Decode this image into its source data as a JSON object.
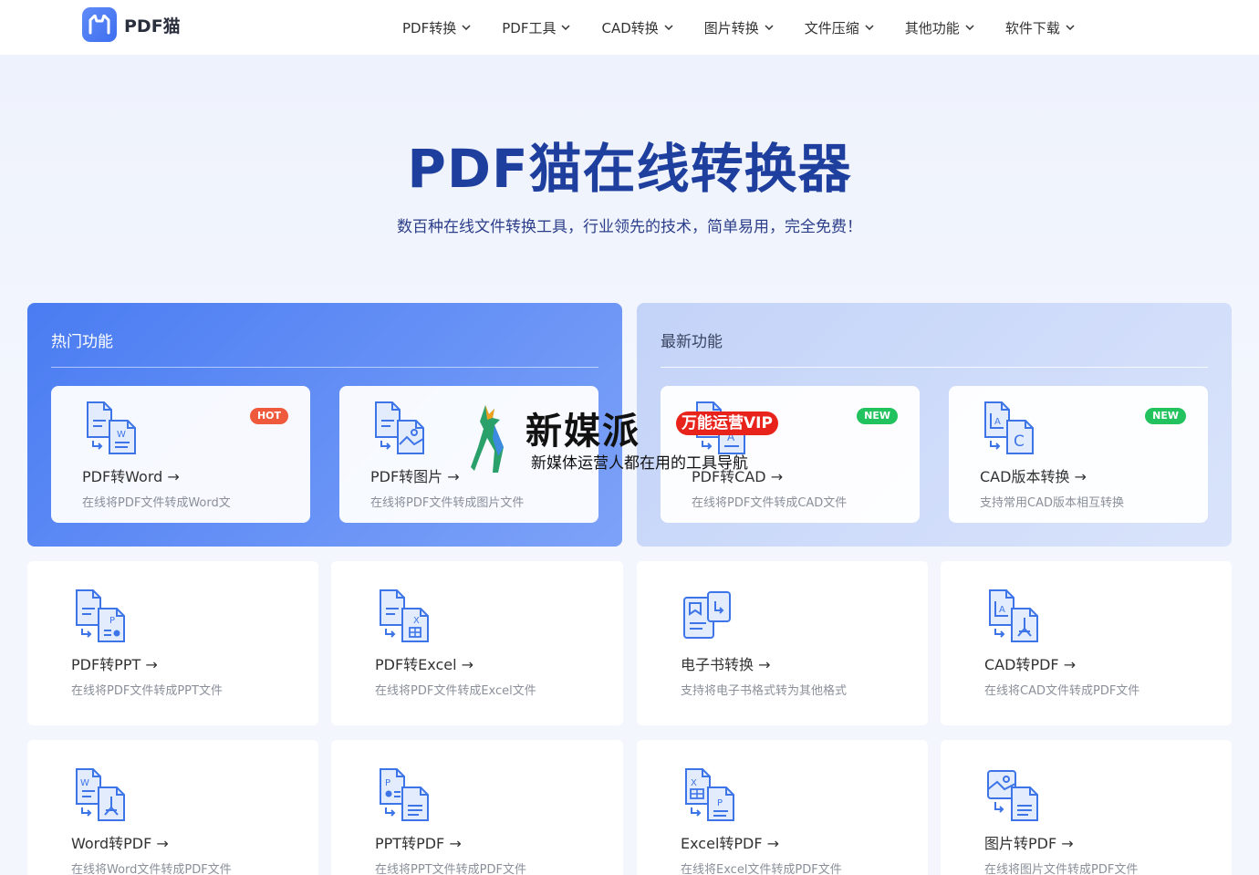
{
  "brand": {
    "name": "PDF猫"
  },
  "nav": [
    {
      "label": "PDF转换"
    },
    {
      "label": "PDF工具"
    },
    {
      "label": "CAD转换"
    },
    {
      "label": "图片转换"
    },
    {
      "label": "文件压缩"
    },
    {
      "label": "其他功能"
    },
    {
      "label": "软件下载"
    }
  ],
  "hero": {
    "title": "PDF猫在线转换器",
    "subtitle": "数百种在线文件转换工具，行业领先的技术，简单易用，完全免费！"
  },
  "hot": {
    "title": "热门功能",
    "cards": [
      {
        "title": "PDF转Word →",
        "desc": "在线将PDF文件转成Word文",
        "badge": "HOT",
        "icon": "pdf-to-word-icon"
      },
      {
        "title": "PDF转图片 →",
        "desc": "在线将PDF文件转成图片文件",
        "badge": "",
        "icon": "pdf-to-image-icon"
      }
    ]
  },
  "latest": {
    "title": "最新功能",
    "cards": [
      {
        "title": "PDF转CAD →",
        "desc": "在线将PDF文件转成CAD文件",
        "badge": "NEW",
        "icon": "pdf-to-cad-icon"
      },
      {
        "title": "CAD版本转换 →",
        "desc": "支持常用CAD版本相互转换",
        "badge": "NEW",
        "icon": "cad-version-convert-icon"
      }
    ]
  },
  "tools": [
    {
      "title": "PDF转PPT →",
      "desc": "在线将PDF文件转成PPT文件",
      "icon": "pdf-to-ppt-icon"
    },
    {
      "title": "PDF转Excel →",
      "desc": "在线将PDF文件转成Excel文件",
      "icon": "pdf-to-excel-icon"
    },
    {
      "title": "电子书转换 →",
      "desc": "支持将电子书格式转为其他格式",
      "icon": "ebook-convert-icon"
    },
    {
      "title": "CAD转PDF →",
      "desc": "在线将CAD文件转成PDF文件",
      "icon": "cad-to-pdf-icon"
    },
    {
      "title": "Word转PDF →",
      "desc": "在线将Word文件转成PDF文件",
      "icon": "word-to-pdf-icon"
    },
    {
      "title": "PPT转PDF →",
      "desc": "在线将PPT文件转成PDF文件",
      "icon": "ppt-to-pdf-icon"
    },
    {
      "title": "Excel转PDF →",
      "desc": "在线将Excel文件转成PDF文件",
      "icon": "excel-to-pdf-icon"
    },
    {
      "title": "图片转PDF →",
      "desc": "在线将图片文件转成PDF文件",
      "icon": "image-to-pdf-icon"
    }
  ],
  "watermark": {
    "name": "新媒派",
    "vip": "万能运营VIP",
    "tagline": "新媒体运营人都在用的工具导航"
  },
  "colors": {
    "accent": "#4a7cf2",
    "title": "#1f3f9e",
    "hot": "#ef5a3c",
    "new": "#22c35e"
  }
}
